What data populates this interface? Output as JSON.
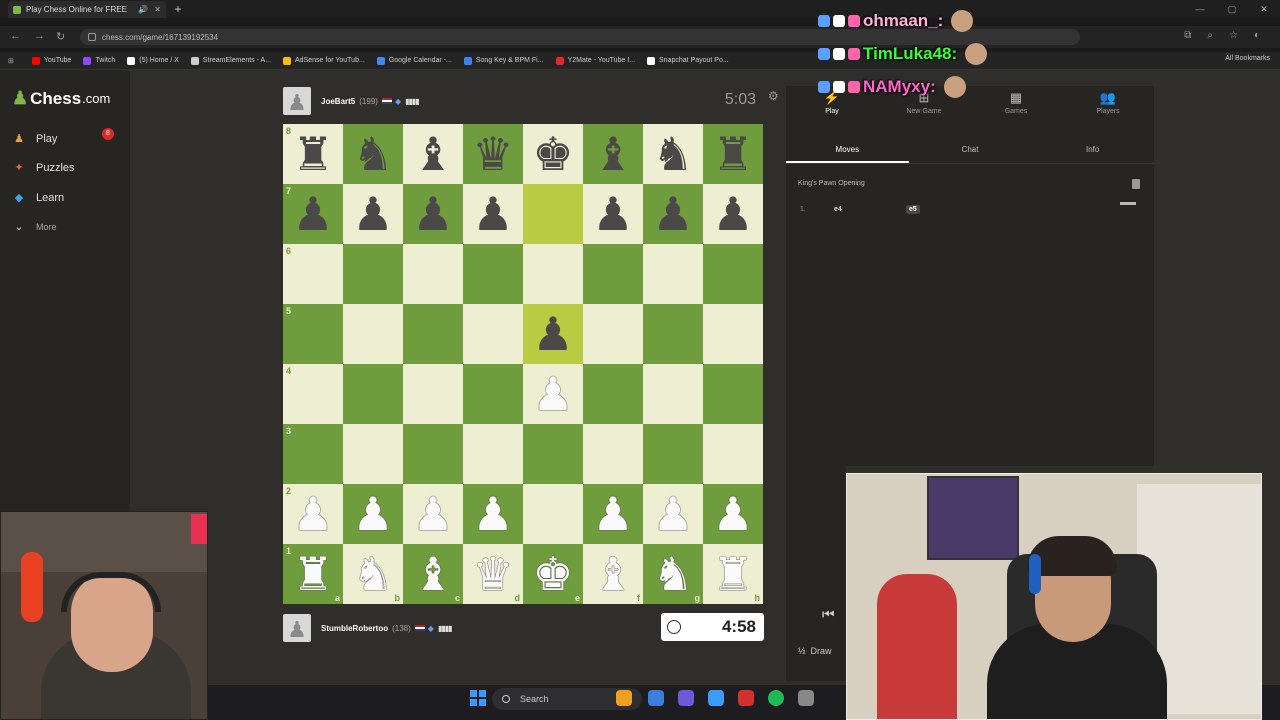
{
  "browser": {
    "tab_title": "Play Chess Online for FREE",
    "new_tab_label": "+",
    "url": "chess.com/game/167139192534",
    "bookmarks": [
      {
        "label": "YouTube",
        "color": "#ff0000"
      },
      {
        "label": "Twitch",
        "color": "#9146ff"
      },
      {
        "label": "(5) Home / X",
        "color": "#ffffff"
      },
      {
        "label": "StreamElements - A...",
        "color": "#cccccc"
      },
      {
        "label": "AdSense for YouTub...",
        "color": "#fbbc05"
      },
      {
        "label": "Google Calendar -...",
        "color": "#4285f4"
      },
      {
        "label": "Song Key & BPM Fi...",
        "color": "#3b82f6"
      },
      {
        "label": "Y2Mate - YouTube I...",
        "color": "#e02828"
      },
      {
        "label": "Snapchat Payout Po...",
        "color": "#ffffff"
      }
    ],
    "all_bookmarks_label": "All Bookmarks"
  },
  "site": {
    "logo_main": "Chess",
    "logo_suffix": ".com",
    "nav": [
      {
        "label": "Play",
        "icon": "play-bolt-icon",
        "color": "#e8a23a"
      },
      {
        "label": "Puzzles",
        "icon": "puzzle-icon",
        "color": "#e8613a"
      },
      {
        "label": "Learn",
        "icon": "learn-icon",
        "color": "#3aa5e8"
      },
      {
        "label": "More",
        "icon": "chevron-down-icon",
        "color": "#cccccc"
      }
    ],
    "play_badge": "8"
  },
  "game": {
    "top_player": {
      "name": "JoeBart5",
      "rating": "(199)"
    },
    "top_clock": "5:03",
    "bottom_player": {
      "name": "StumbleRobertoo",
      "rating": "(138)"
    },
    "bottom_clock": "4:58",
    "board": [
      [
        "r",
        "n",
        "b",
        "q",
        "k",
        "b",
        "n",
        "r"
      ],
      [
        "p",
        "p",
        "p",
        "p",
        "",
        "p",
        "p",
        "p"
      ],
      [
        "",
        "",
        "",
        "",
        "",
        "",
        "",
        ""
      ],
      [
        "",
        "",
        "",
        "",
        "p",
        "",
        "",
        ""
      ],
      [
        "",
        "",
        "",
        "",
        "P",
        "",
        "",
        ""
      ],
      [
        "",
        "",
        "",
        "",
        "",
        "",
        "",
        ""
      ],
      [
        "P",
        "P",
        "P",
        "P",
        "",
        "P",
        "P",
        "P"
      ],
      [
        "R",
        "N",
        "B",
        "Q",
        "K",
        "B",
        "N",
        "R"
      ]
    ],
    "highlighted": [
      "e7",
      "e5"
    ],
    "ranks": [
      "8",
      "7",
      "6",
      "5",
      "4",
      "3",
      "2",
      "1"
    ],
    "files": [
      "a",
      "b",
      "c",
      "d",
      "e",
      "f",
      "g",
      "h"
    ]
  },
  "panel": {
    "tabs": [
      {
        "label": "Play",
        "icon": "bolt-icon"
      },
      {
        "label": "New Game",
        "icon": "plus-icon"
      },
      {
        "label": "Games",
        "icon": "board-icon"
      },
      {
        "label": "Players",
        "icon": "players-icon"
      }
    ],
    "subtabs": [
      "Moves",
      "Chat",
      "Info"
    ],
    "opening": "King's Pawn Opening",
    "moves": [
      {
        "num": "1.",
        "white": "e4",
        "black": "e5"
      }
    ],
    "first_move_icon": "first-move-icon",
    "draw_label": "Draw",
    "draw_fraction": "½"
  },
  "taskbar": {
    "search_label": "Search"
  },
  "stream": {
    "chat": [
      {
        "name": "ohmaan_:",
        "color": "#ffb3d9"
      },
      {
        "name": "TimLuka48:",
        "color": "#33ff33"
      },
      {
        "name": "NAMyxy:",
        "color": "#ff66cc"
      }
    ]
  }
}
